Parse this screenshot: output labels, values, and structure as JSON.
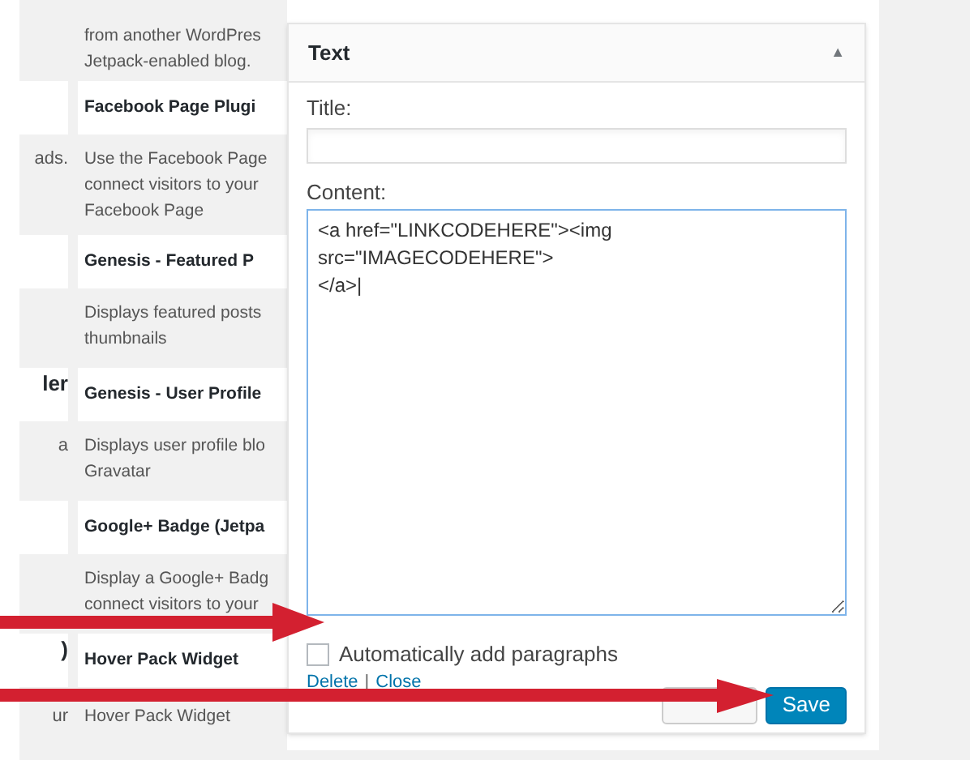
{
  "widget_rows": [
    {
      "kind": "description",
      "right": "from another WordPres\nJetpack-enabled blog."
    },
    {
      "kind": "title",
      "right": "Facebook Page Plugi"
    },
    {
      "kind": "description",
      "left": "ads.",
      "right": "Use the Facebook Page\nconnect visitors to your\nFacebook Page"
    },
    {
      "kind": "title",
      "right": "Genesis - Featured P"
    },
    {
      "kind": "description",
      "right": "Displays featured posts\nthumbnails"
    },
    {
      "kind": "title",
      "left": "ler",
      "right": "Genesis - User Profile"
    },
    {
      "kind": "description",
      "left": "a",
      "right": "Displays user profile blo\nGravatar"
    },
    {
      "kind": "title",
      "right": "Google+ Badge (Jetpa"
    },
    {
      "kind": "description",
      "right": "Display a Google+ Badg\nconnect visitors to your"
    },
    {
      "kind": "title",
      "left": ")",
      "right": "Hover Pack Widget"
    },
    {
      "kind": "description",
      "left": "ur",
      "right": "Hover Pack Widget"
    }
  ],
  "panel": {
    "title": "Text",
    "toggle": "▲",
    "expanded": true,
    "title_label": "Title:",
    "content_label": "Content:",
    "content_value": "<a href=\"LINKCODEHERE\"><img src=\"IMAGECODEHERE\">\n</a>|",
    "auto_paragraphs": {
      "label": "Automatically add paragraphs",
      "checked": false
    },
    "links": [
      "Delete",
      "|",
      "Close"
    ],
    "save_button": "Save"
  }
}
